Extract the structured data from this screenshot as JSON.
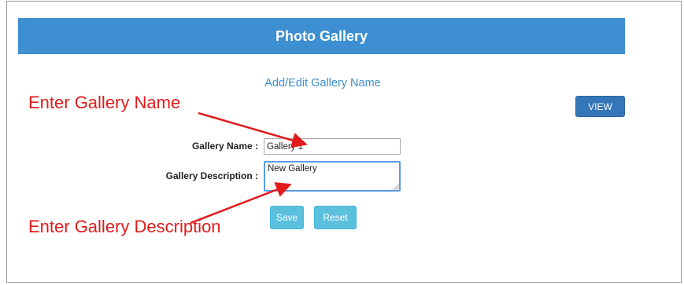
{
  "header": {
    "title": "Photo Gallery"
  },
  "form": {
    "subtitle": "Add/Edit Gallery Name",
    "view_label": "VIEW",
    "name_label": "Gallery Name :",
    "name_value": "Gallery 1",
    "desc_label": "Gallery Description :",
    "desc_value": "New Gallery",
    "save_label": "Save",
    "reset_label": "Reset"
  },
  "annotations": {
    "name_hint": "Enter Gallery Name",
    "desc_hint": "Enter Gallery Description"
  },
  "colors": {
    "header_bg": "#3d8fd1",
    "accent_text": "#3d8fd1",
    "view_button": "#3476b8",
    "action_button": "#5bc0de",
    "annotation": "#e11b1b"
  }
}
